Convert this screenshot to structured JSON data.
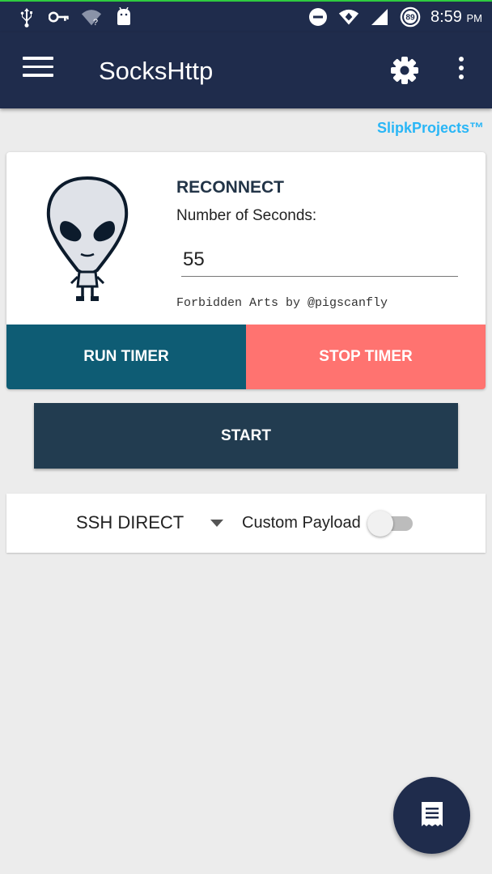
{
  "status_bar": {
    "time": "8:59",
    "ampm": "PM",
    "battery_level": "89",
    "left_icons": [
      "usb-icon",
      "vpn-key-icon",
      "wifi-unknown-icon",
      "android-icon"
    ],
    "right_icons": [
      "do-not-disturb-icon",
      "wifi-icon",
      "signal-icon",
      "battery-icon"
    ]
  },
  "app_bar": {
    "title": "SocksHttp",
    "icons": [
      "menu-icon",
      "gear-icon",
      "more-vert-icon"
    ]
  },
  "brand": "SlipkProjects™",
  "reconnect_card": {
    "heading": "RECONNECT",
    "label": "Number of Seconds:",
    "seconds_value": "55",
    "credit": "Forbidden Arts by @pigscanfly",
    "run_label": "RUN TIMER",
    "stop_label": "STOP TIMER"
  },
  "start_label": "START",
  "connection": {
    "mode": "SSH DIRECT",
    "payload_label": "Custom Payload",
    "payload_enabled": false
  },
  "fab_icon": "log-icon",
  "colors": {
    "primary": "#1f2c4c",
    "run_timer": "#0e5c74",
    "stop_timer": "#ff7370",
    "start": "#223c50",
    "brand": "#29b6f6"
  }
}
